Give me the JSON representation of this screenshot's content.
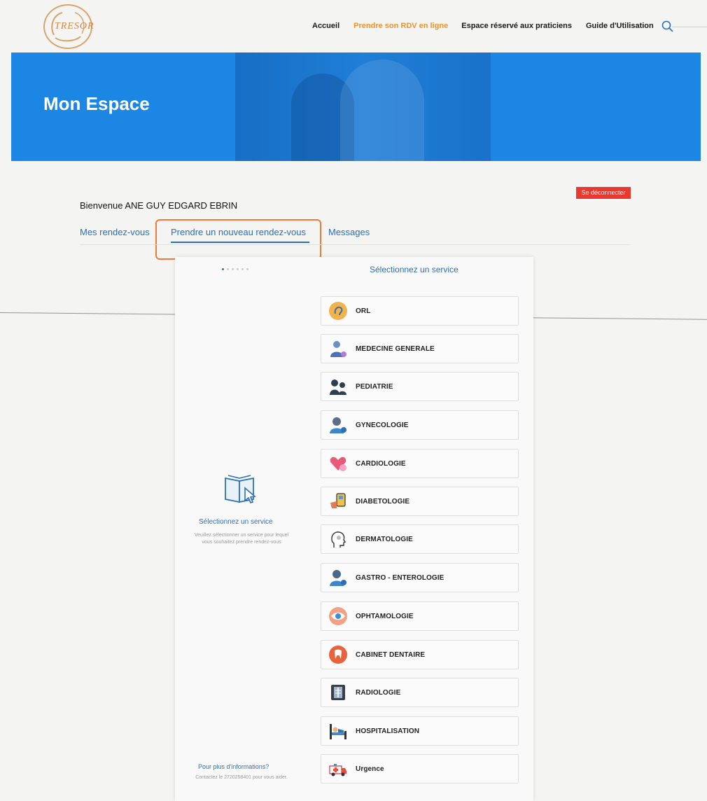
{
  "logo": {
    "text": "TRESOR"
  },
  "nav": {
    "items": [
      "Accueil",
      "Prendre son RDV en ligne",
      "Espace réservé aux praticiens",
      "Guide d'Utilisation"
    ]
  },
  "banner": {
    "title": "Mon Espace"
  },
  "account": {
    "logout_label": "Se déconnecter",
    "welcome": "Bienvenue ANE GUY EDGARD EBRIN"
  },
  "tabs": [
    "Mes rendez-vous",
    "Prendre un nouveau rendez-vous",
    "Messages"
  ],
  "card": {
    "title": "Sélectionnez un service",
    "side_title": "Sélectionnez un service",
    "side_desc": "Veuillez sélectionner un service pour lequel vous souhaitez prendre rendez-vous",
    "info_title": "Pour plus d'informations?",
    "info_desc": "Contactez le 2720258401 pour vous aider."
  },
  "services": [
    {
      "label": "ORL",
      "icon": "ear-icon"
    },
    {
      "label": "MEDECINE GENERALE",
      "icon": "doctor-icon"
    },
    {
      "label": "PEDIATRIE",
      "icon": "children-icon"
    },
    {
      "label": "GYNECOLOGIE",
      "icon": "gynecologist-icon"
    },
    {
      "label": "CARDIOLOGIE",
      "icon": "heart-icon"
    },
    {
      "label": "DIABETOLOGIE",
      "icon": "glucose-meter-icon"
    },
    {
      "label": "DERMATOLOGIE",
      "icon": "face-icon"
    },
    {
      "label": "GASTRO - ENTEROLOGIE",
      "icon": "gastro-doctor-icon"
    },
    {
      "label": "OPHTAMOLOGIE",
      "icon": "eye-icon"
    },
    {
      "label": "CABINET DENTAIRE",
      "icon": "tooth-icon"
    },
    {
      "label": "RADIOLOGIE",
      "icon": "xray-icon"
    },
    {
      "label": "HOSPITALISATION",
      "icon": "hospital-bed-icon"
    },
    {
      "label": "Urgence",
      "icon": "ambulance-icon"
    }
  ],
  "colors": {
    "accent": "#2a6fb8",
    "banner": "#1b86e3",
    "nav_active": "#f39223",
    "logout": "#e8382f",
    "highlight": "#ee7a3c"
  }
}
